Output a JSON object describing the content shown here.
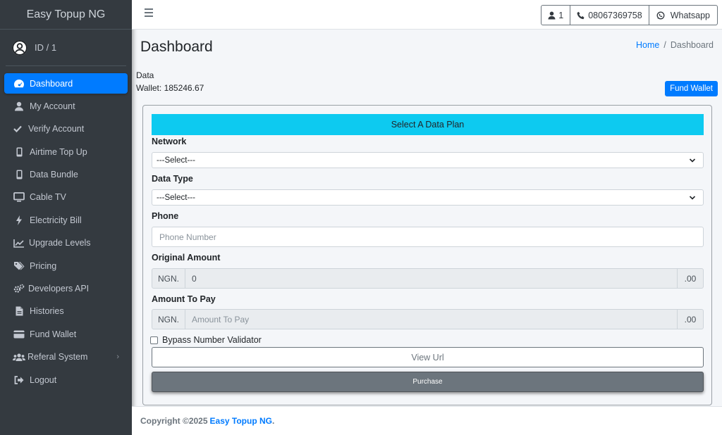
{
  "sidebar": {
    "brand": "Easy Topup NG",
    "user_id": "ID / 1",
    "items": [
      {
        "label": "Dashboard",
        "icon": "dashboard-icon"
      },
      {
        "label": "My Account",
        "icon": "user-icon"
      },
      {
        "label": "Verify Account",
        "icon": "check-icon"
      },
      {
        "label": "Airtime Top Up",
        "icon": "mobile-icon"
      },
      {
        "label": "Data Bundle",
        "icon": "mobile-icon"
      },
      {
        "label": "Cable TV",
        "icon": "tv-icon"
      },
      {
        "label": "Electricity Bill",
        "icon": "bolt-icon"
      },
      {
        "label": "Upgrade Levels",
        "icon": "chart-line-icon"
      },
      {
        "label": "Pricing",
        "icon": "tags-icon"
      },
      {
        "label": "Developers API",
        "icon": "cogs-icon"
      },
      {
        "label": "Histories",
        "icon": "file-icon"
      },
      {
        "label": "Fund Wallet",
        "icon": "credit-card-icon"
      },
      {
        "label": "Referal System",
        "icon": "users-icon"
      },
      {
        "label": "Logout",
        "icon": "sign-out-icon"
      }
    ],
    "active_color": "#007bff"
  },
  "topbar": {
    "user_count": "1",
    "phone": "08067369758",
    "whatsapp": "Whatsapp"
  },
  "page": {
    "title": "Dashboard",
    "breadcrumb_home": "Home",
    "breadcrumb_sep": "/",
    "breadcrumb_current": "Dashboard"
  },
  "wallet": {
    "line1": "Data",
    "line2": "Wallet: 185246.67",
    "fund_button": "Fund Wallet"
  },
  "form": {
    "header": "Select A Data Plan",
    "network_label": "Network",
    "network_value": "---Select---",
    "datatype_label": "Data Type",
    "datatype_value": "---Select---",
    "phone_label": "Phone",
    "phone_placeholder": "Phone Number",
    "original_label": "Original Amount",
    "currency": "NGN.",
    "original_value": "0",
    "cents": ".00",
    "pay_label": "Amount To Pay",
    "pay_placeholder": "Amount To Pay",
    "bypass_label": "Bypass Number Validator",
    "view_url": "View Url",
    "purchase": "Purchase",
    "header_color": "#0dcaf0"
  },
  "footer": {
    "copyright": "Copyright ©2025",
    "brand": "Easy Topup NG",
    "period": "."
  }
}
